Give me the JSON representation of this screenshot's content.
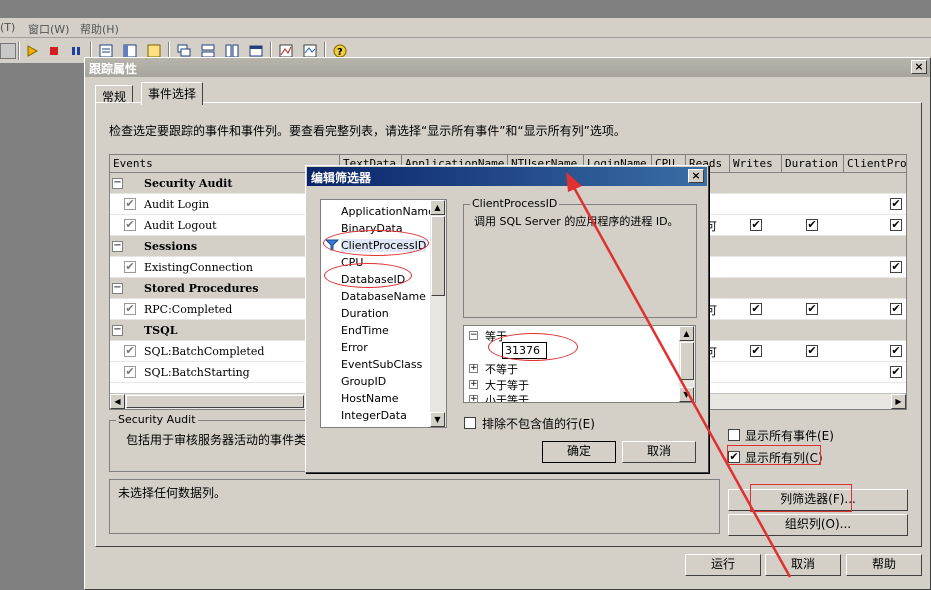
{
  "app_menu": {
    "items": [
      "(T)",
      "窗口(W)",
      "帮助(H)"
    ]
  },
  "toolbar": {
    "icons": [
      "new-trace-icon",
      "run-icon",
      "stop-icon",
      "pause-icon",
      "properties-icon",
      "template-icon",
      "columns-icon",
      "window-cascade-icon",
      "window-tile-h-icon",
      "window-tile-v-icon",
      "window-icon",
      "chart-icon",
      "chart2-icon",
      "help-icon"
    ]
  },
  "trace_dialog": {
    "title": "跟踪属性",
    "close": "×",
    "tabs": [
      {
        "label": "常规",
        "active": false
      },
      {
        "label": "事件选择",
        "active": true
      }
    ],
    "instructions": "检查选定要跟踪的事件和事件列。要查看完整列表，请选择“显示所有事件”和“显示所有列”选项。",
    "grid": {
      "columns": [
        "Events",
        "TextData",
        "ApplicationName",
        "NTUserName",
        "LoginName",
        "CPU",
        "Reads",
        "Writes",
        "Duration",
        "ClientProc"
      ],
      "rows": [
        {
          "type": "category",
          "label": "Security Audit"
        },
        {
          "type": "event",
          "label": "Audit Login"
        },
        {
          "type": "event",
          "label": "Audit Logout"
        },
        {
          "type": "category",
          "label": "Sessions"
        },
        {
          "type": "event",
          "label": "ExistingConnection"
        },
        {
          "type": "category",
          "label": "Stored Procedures"
        },
        {
          "type": "event",
          "label": "RPC:Completed"
        },
        {
          "type": "category",
          "label": "TSQL"
        },
        {
          "type": "event",
          "label": "SQL:BatchCompleted"
        },
        {
          "type": "event",
          "label": "SQL:BatchStarting"
        }
      ],
      "check_mark": "✔",
      "partial_mark": "可"
    },
    "event_group": {
      "title": "Security Audit",
      "text": "包括用于审核服务器活动的事件类"
    },
    "show_all_events": {
      "label": "显示所有事件(E)",
      "checked": false
    },
    "show_all_columns": {
      "label": "显示所有列(C)",
      "checked": true
    },
    "column_info": "未选择任何数据列。",
    "column_filter_button": "列筛选器(F)...",
    "organize_columns_button": "组织列(O)...",
    "run_button": "运行",
    "cancel_button": "取消",
    "help_button": "帮助"
  },
  "filter_dialog": {
    "title": "编辑筛选器",
    "close": "×",
    "columns": [
      "ApplicationName",
      "BinaryData",
      "ClientProcessID",
      "CPU",
      "DatabaseID",
      "DatabaseName",
      "Duration",
      "EndTime",
      "Error",
      "EventSubClass",
      "GroupID",
      "HostName",
      "IntegerData"
    ],
    "selected_column": "ClientProcessID",
    "description_title": "ClientProcessID",
    "description": "调用 SQL Server 的应用程序的进程 ID。",
    "conditions": [
      {
        "label": "等于",
        "expanded": true,
        "value": "31376"
      },
      {
        "label": "不等于",
        "expanded": false
      },
      {
        "label": "大于等于",
        "expanded": false
      },
      {
        "label": "小于等于",
        "expanded": false
      }
    ],
    "exclude_nulls": {
      "label": "排除不包含值的行(E)",
      "checked": false
    },
    "ok_button": "确定",
    "cancel_button": "取消"
  },
  "colors": {
    "annotation_red": "#e03030",
    "title_active": "#0a246a",
    "dialog_face": "#d4d0c8"
  }
}
